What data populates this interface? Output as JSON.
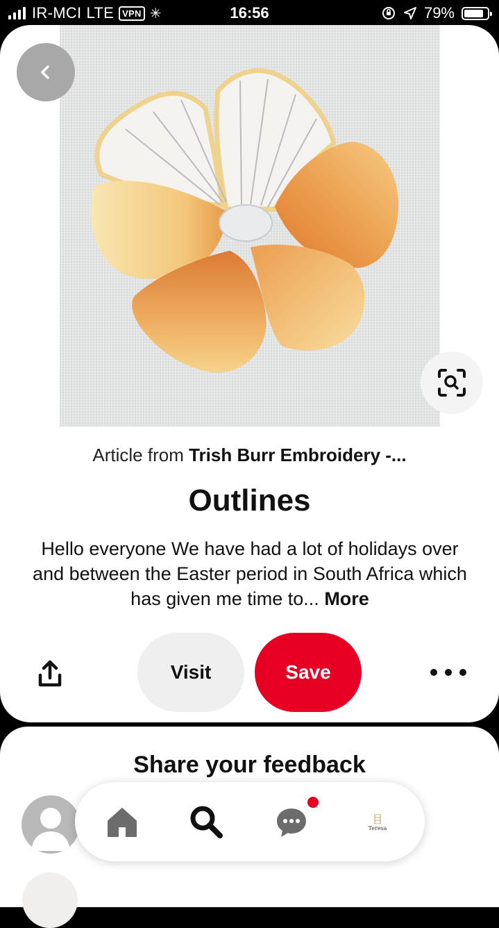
{
  "status_bar": {
    "carrier": "IR-MCI",
    "network": "LTE",
    "vpn": "VPN",
    "time": "16:56",
    "battery": "79%"
  },
  "pin": {
    "source_prefix": "Article from",
    "source_name": "Trish Burr Embroidery -...",
    "title": "Outlines",
    "description": "Hello everyone We have had a lot of holidays over and between the Easter period in South Africa which has given me time to...",
    "more_label": "More"
  },
  "actions": {
    "visit_label": "Visit",
    "save_label": "Save"
  },
  "feedback": {
    "title": "Share your feedback"
  },
  "nav": {
    "profile_brand": "Teresa"
  },
  "colors": {
    "save_red": "#e60023",
    "visit_gray": "#efefef",
    "notification_dot": "#e60023"
  }
}
